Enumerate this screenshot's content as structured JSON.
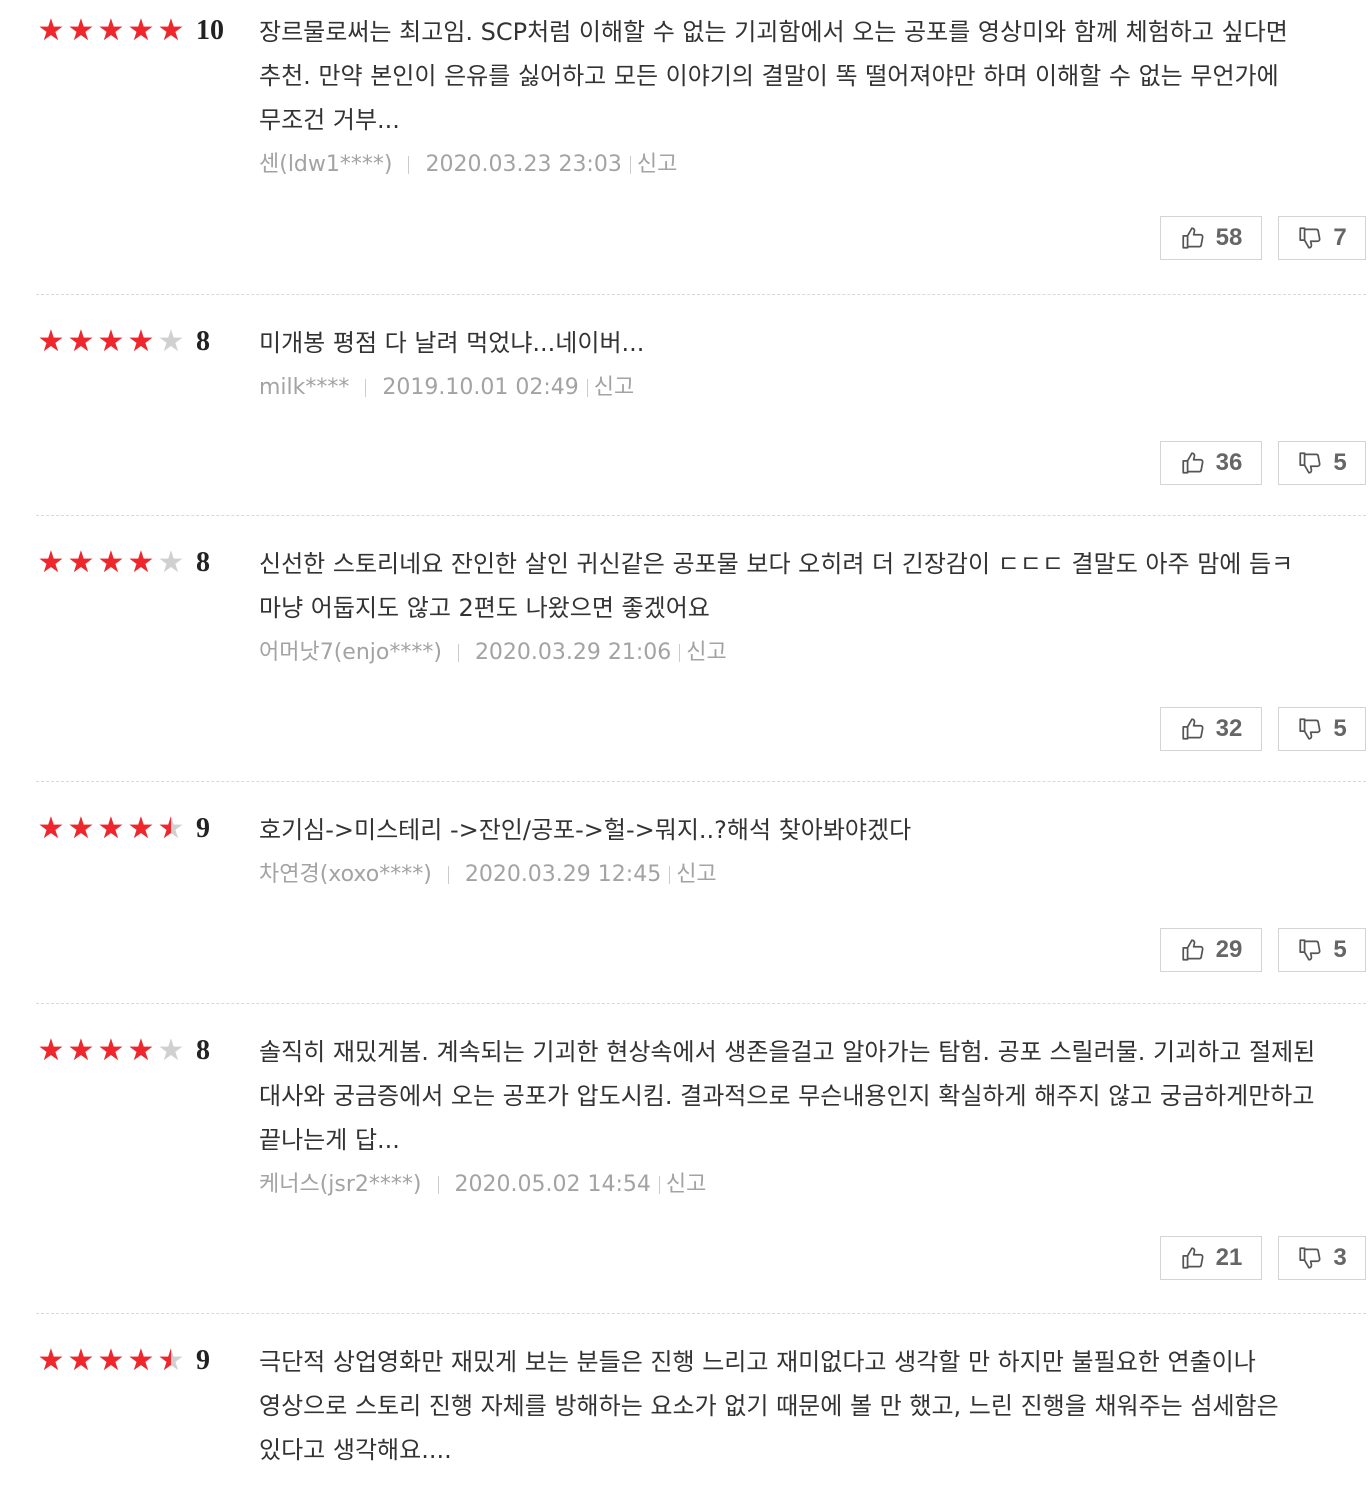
{
  "reviews": [
    {
      "score": "10",
      "rating": 5,
      "text": "장르물로써는 최고임. SCP처럼 이해할 수 없는 기괴함에서 오는 공포를 영상미와 함께 체험하고 싶다면 추천. 만약 본인이 은유를 싫어하고 모든 이야기의 결말이 똑 떨어져야만 하며 이해할 수 없는 무언가에 무조건 거부...",
      "author": "센(ldw1****)",
      "date": "2020.03.23 23:03",
      "report": "신고",
      "likes": "58",
      "dislikes": "7"
    },
    {
      "score": "8",
      "rating": 4,
      "text": "미개봉 평점 다 날려 먹었냐...네이버...",
      "author": "milk****",
      "date": "2019.10.01 02:49",
      "report": "신고",
      "likes": "36",
      "dislikes": "5"
    },
    {
      "score": "8",
      "rating": 4,
      "text": "신선한 스토리네요 잔인한 살인 귀신같은 공포물 보다 오히려 더 긴장감이 ㄷㄷㄷ 결말도 아주 맘에 듬ㅋ 마냥 어둡지도 않고 2편도 나왔으면 좋겠어요",
      "author": "어머낫7(enjo****)",
      "date": "2020.03.29 21:06",
      "report": "신고",
      "likes": "32",
      "dislikes": "5"
    },
    {
      "score": "9",
      "rating": 4.5,
      "text": "호기심->미스테리 ->잔인/공포->헐->뭐지..?해석 찾아봐야겠다",
      "author": "차연경(xoxo****)",
      "date": "2020.03.29 12:45",
      "report": "신고",
      "likes": "29",
      "dislikes": "5"
    },
    {
      "score": "8",
      "rating": 4,
      "text": "솔직히 재밌게봄. 계속되는 기괴한 현상속에서 생존을걸고 알아가는 탐험. 공포 스릴러물. 기괴하고 절제된 대사와 궁금증에서 오는 공포가 압도시킴. 결과적으로 무슨내용인지 확실하게 해주지 않고 궁금하게만하고 끝나는게 답...",
      "author": "케너스(jsr2****)",
      "date": "2020.05.02 14:54",
      "report": "신고",
      "likes": "21",
      "dislikes": "3"
    },
    {
      "score": "9",
      "rating": 4.5,
      "text": "극단적 상업영화만 재밌게 보는 분들은 진행 느리고 재미없다고 생각할 만 하지만 불필요한 연출이나 영상으로 스토리 진행 자체를 방해하는 요소가 없기 때문에 볼 만 했고, 느린 진행을 채워주는 섬세함은 있다고 생각해요...."
    }
  ],
  "colors": {
    "star_filled": "#f0262d",
    "star_empty": "#d0d0d0",
    "meta_text": "#a3a3a3"
  },
  "icons": {
    "like": "thumbs-up-icon",
    "dislike": "thumbs-down-icon",
    "star": "star-icon"
  }
}
